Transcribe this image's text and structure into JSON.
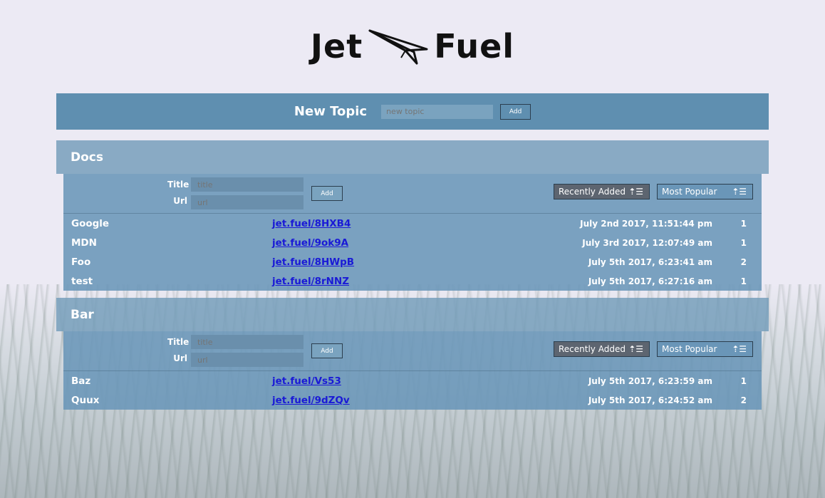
{
  "logo": {
    "left": "Jet",
    "right": "Fuel"
  },
  "new_topic": {
    "label": "New Topic",
    "placeholder": "new topic",
    "add_label": "Add"
  },
  "topics": [
    {
      "name": "Docs",
      "form": {
        "title_label": "Title",
        "title_placeholder": "title",
        "url_label": "Url",
        "url_placeholder": "url",
        "add_label": "Add"
      },
      "sort": {
        "recent": "Recently Added",
        "popular": "Most Popular"
      },
      "links": [
        {
          "name": "Google",
          "short": "jet.fuel/8HXB4",
          "date": "July 2nd 2017, 11:51:44 pm",
          "count": "1"
        },
        {
          "name": "MDN",
          "short": "jet.fuel/9ok9A",
          "date": "July 3rd 2017, 12:07:49 am",
          "count": "1"
        },
        {
          "name": "Foo",
          "short": "jet.fuel/8HWpB",
          "date": "July 5th 2017, 6:23:41 am",
          "count": "2"
        },
        {
          "name": "test",
          "short": "jet.fuel/8rNNZ",
          "date": "July 5th 2017, 6:27:16 am",
          "count": "1"
        }
      ]
    },
    {
      "name": "Bar",
      "form": {
        "title_label": "Title",
        "title_placeholder": "title",
        "url_label": "Url",
        "url_placeholder": "url",
        "add_label": "Add"
      },
      "sort": {
        "recent": "Recently Added",
        "popular": "Most Popular"
      },
      "links": [
        {
          "name": "Baz",
          "short": "jet.fuel/Vs53",
          "date": "July 5th 2017, 6:23:59 am",
          "count": "1"
        },
        {
          "name": "Quux",
          "short": "jet.fuel/9dZQv",
          "date": "July 5th 2017, 6:24:52 am",
          "count": "2"
        }
      ]
    }
  ]
}
